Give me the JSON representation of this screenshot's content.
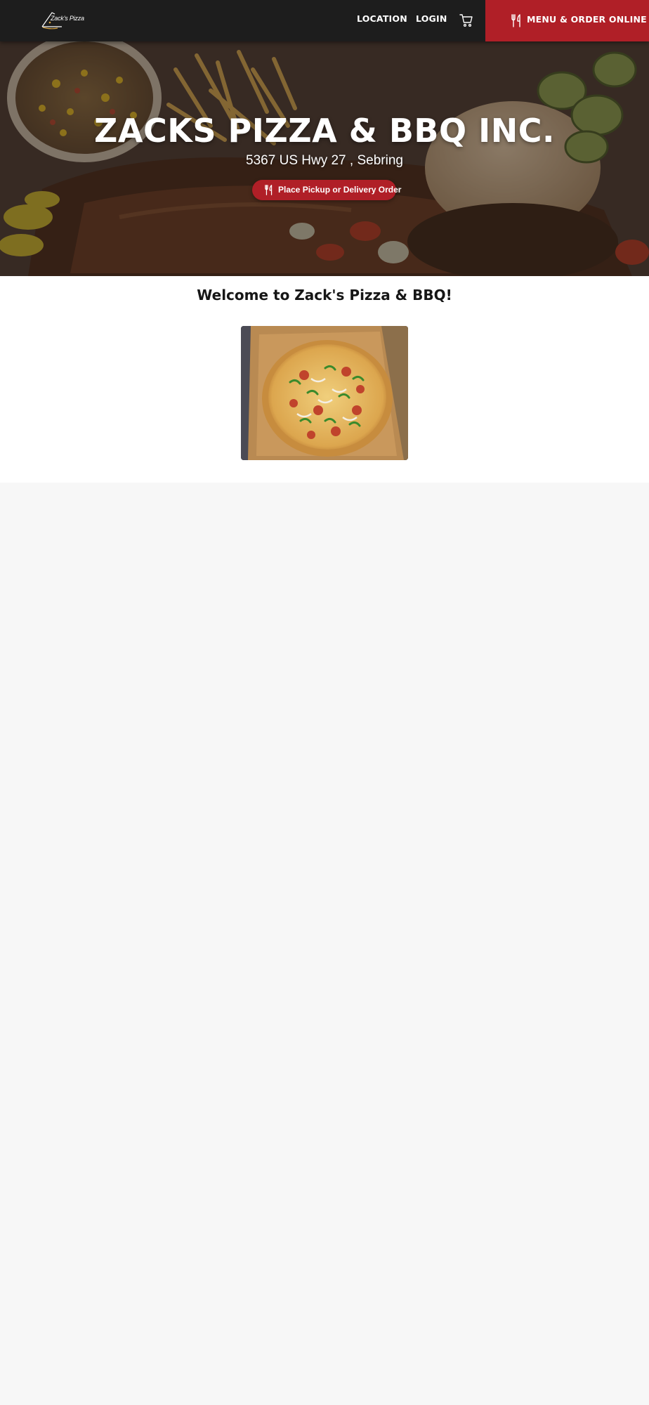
{
  "nav": {
    "logo_text": "Zack's Pizza",
    "location_label": "LOCATION",
    "login_label": "LOGIN",
    "order_label": "MENU & ORDER ONLINE"
  },
  "hero": {
    "title": "ZACKS PIZZA & BBQ INC.",
    "address": "5367 US Hwy 27 , Sebring",
    "cta_label": "Place Pickup or Delivery Order"
  },
  "welcome": {
    "heading": "Welcome to Zack's Pizza & BBQ!"
  },
  "colors": {
    "navbar": "#1d1d1d",
    "brand_red": "#b01f27",
    "page_bg": "#f7f7f7"
  },
  "icons": [
    "cart-icon",
    "utensils-icon"
  ]
}
